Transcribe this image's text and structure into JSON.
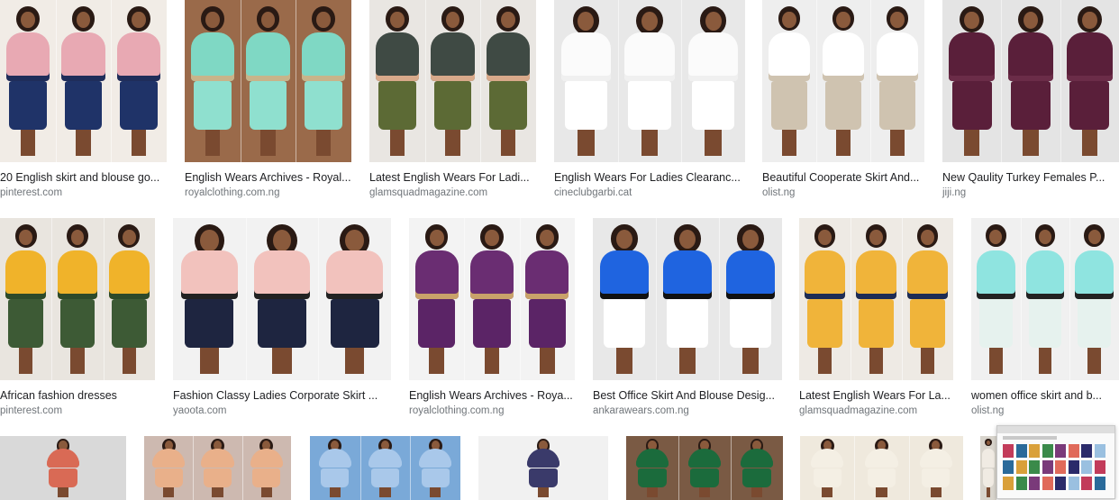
{
  "row1": [
    {
      "title": "20 English skirt and blouse go...",
      "source": "pinterest.com",
      "colors": {
        "bg": "#f1ece6",
        "top": "#e8a9b3",
        "accent": "#1f2d5a",
        "skirt": "#1f3368"
      }
    },
    {
      "title": "English Wears Archives - Royal...",
      "source": "royalclothing.com.ng",
      "colors": {
        "bg": "#9a6a4a",
        "top": "#7fd8c4",
        "accent": "#c8b48a",
        "skirt": "#8fe0cf"
      }
    },
    {
      "title": "Latest English Wears For Ladi...",
      "source": "glamsquadmagazine.com",
      "colors": {
        "bg": "#e9e6e2",
        "top": "#3f4a44",
        "accent": "#d8a98a",
        "skirt": "#5c6a35"
      }
    },
    {
      "title": "English Wears For Ladies Clearanc...",
      "source": "cineclubgarbi.cat",
      "colors": {
        "bg": "#e8e8e8",
        "top": "#fbfbfb",
        "accent": "#f0f0f0",
        "skirt": "#ffffff"
      }
    },
    {
      "title": "Beautiful Cooperate Skirt And...",
      "source": "olist.ng",
      "colors": {
        "bg": "#eeeeee",
        "top": "#ffffff",
        "accent": "#cfc3b0",
        "skirt": "#cfc3b0"
      }
    },
    {
      "title": "New Qaulity Turkey Females P...",
      "source": "jiji.ng",
      "colors": {
        "bg": "#e4e4e4",
        "top": "#5a1f3a",
        "accent": "#6b2c48",
        "skirt": "#5a1f3a"
      }
    }
  ],
  "row2": [
    {
      "title": "African fashion dresses",
      "source": "pinterest.com",
      "colors": {
        "bg": "#e9e5df",
        "top": "#f0b32a",
        "accent": "#2d4a2a",
        "skirt": "#3d5a35"
      }
    },
    {
      "title": "Fashion Classy Ladies Corporate Skirt ...",
      "source": "yaoota.com",
      "colors": {
        "bg": "#f2f2f2",
        "top": "#f2c2bd",
        "accent": "#222222",
        "skirt": "#1e2540"
      }
    },
    {
      "title": "English Wears Archives - Roya...",
      "source": "royalclothing.com.ng",
      "colors": {
        "bg": "#f3f3f3",
        "top": "#6a2d72",
        "accent": "#c9a26a",
        "skirt": "#5b2466"
      }
    },
    {
      "title": "Best Office Skirt And Blouse Desig...",
      "source": "ankarawears.com.ng",
      "colors": {
        "bg": "#e8e8e8",
        "top": "#1f64e0",
        "accent": "#111111",
        "skirt": "#ffffff"
      }
    },
    {
      "title": "Latest English Wears For La...",
      "source": "glamsquadmagazine.com",
      "colors": {
        "bg": "#eeeae4",
        "top": "#f0b43a",
        "accent": "#1d2c55",
        "skirt": "#f0b43a"
      }
    },
    {
      "title": "women office skirt and b...",
      "source": "olist.ng",
      "colors": {
        "bg": "#f0f0f0",
        "top": "#8fe4e0",
        "accent": "#222222",
        "skirt": "#e6f2ee"
      }
    }
  ],
  "row3": [
    {
      "colors": {
        "bg": "#d9d9d9",
        "top": "#d96a55"
      }
    },
    {
      "colors": {
        "bg": "#cdb9b0",
        "top": "#e9b08a"
      }
    },
    {
      "colors": {
        "bg": "#7aa9d8",
        "top": "#a9c8ea"
      }
    },
    {
      "colors": {
        "bg": "#f1f1f1",
        "top": "#3a3a6a"
      }
    },
    {
      "colors": {
        "bg": "#7a5a44",
        "top": "#1b6b3c"
      }
    },
    {
      "colors": {
        "bg": "#efe9dd",
        "top": "#f4efe4"
      }
    },
    {
      "colors": {
        "bg": "#d8d4cc",
        "top": "#f0ebe3"
      }
    }
  ]
}
